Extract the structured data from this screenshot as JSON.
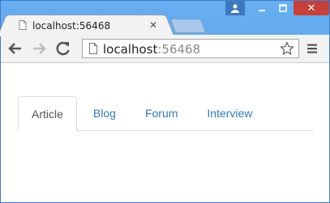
{
  "browser": {
    "tab_title": "localhost:56468",
    "url_host": "localhost",
    "url_port": ":56468",
    "icons": {
      "back": "back-arrow-icon",
      "forward": "forward-arrow-icon",
      "reload": "reload-icon",
      "page": "page-icon",
      "star": "star-icon",
      "menu": "hamburger-menu-icon",
      "user": "user-icon",
      "close_tab": "close-icon"
    },
    "window_controls": [
      "user",
      "minimize",
      "maximize",
      "close"
    ]
  },
  "page": {
    "tabs": [
      {
        "label": "Article",
        "active": true
      },
      {
        "label": "Blog",
        "active": false
      },
      {
        "label": "Forum",
        "active": false
      },
      {
        "label": "Interview",
        "active": false
      }
    ],
    "colors": {
      "link": "#337ab7",
      "active_text": "#555555",
      "border": "#dddddd"
    }
  }
}
